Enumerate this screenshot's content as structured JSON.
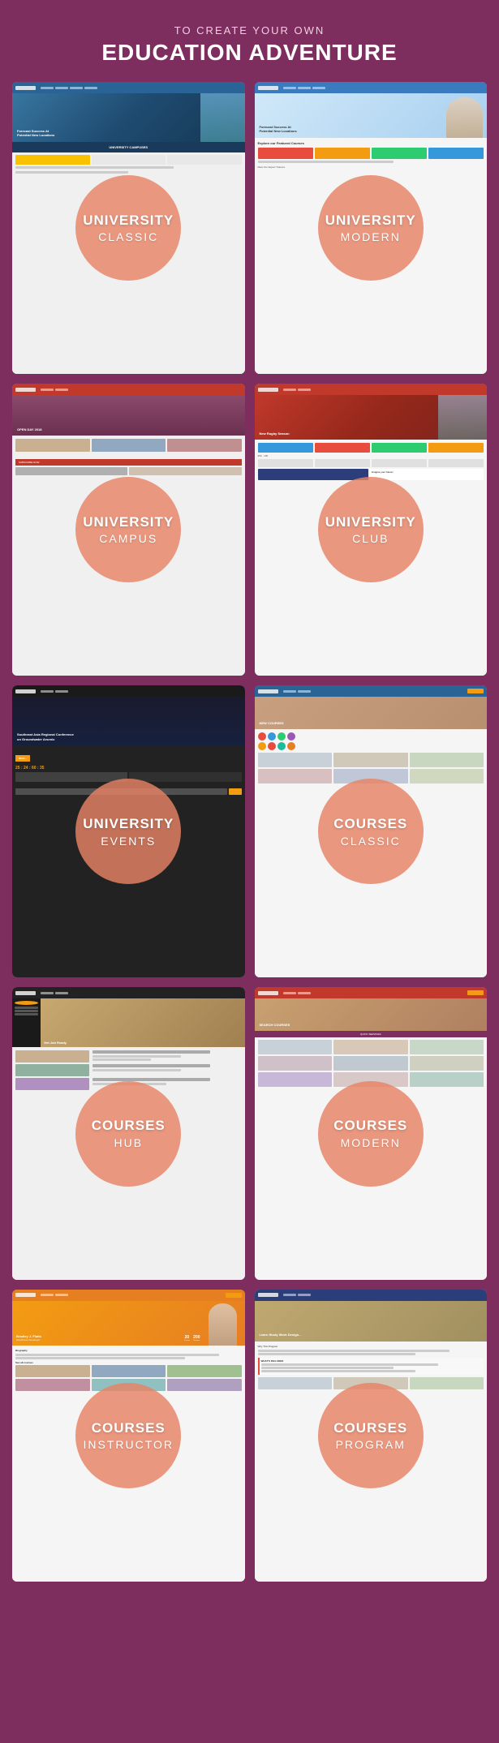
{
  "header": {
    "subtitle": "TO CREATE YOUR OWN",
    "title": "EDUCATION ADVENTURE"
  },
  "cards": [
    {
      "id": "university-classic",
      "category": "UNIVERSITY",
      "name": "CLASSIC",
      "theme": "blue"
    },
    {
      "id": "university-modern",
      "category": "UNIVERSITY",
      "name": "MODERN",
      "theme": "blue"
    },
    {
      "id": "university-campus",
      "category": "UNIVERSITY",
      "name": "CAMPUS",
      "theme": "red"
    },
    {
      "id": "university-club",
      "category": "UNIVERSITY",
      "name": "CLUB",
      "theme": "red"
    },
    {
      "id": "university-events",
      "category": "UNIVERSITY",
      "name": "EVENTS",
      "theme": "dark"
    },
    {
      "id": "courses-classic",
      "category": "COURSES",
      "name": "CLASSIC",
      "theme": "blue"
    },
    {
      "id": "courses-hub",
      "category": "COURSES",
      "name": "HUB",
      "theme": "dark"
    },
    {
      "id": "courses-modern",
      "category": "COURSES",
      "name": "MODERN",
      "theme": "red"
    },
    {
      "id": "courses-instructor",
      "category": "COURSES",
      "name": "INSTRUCTOR",
      "theme": "orange"
    },
    {
      "id": "courses-program",
      "category": "COURSES",
      "name": "PROGRAM",
      "theme": "navy"
    }
  ]
}
